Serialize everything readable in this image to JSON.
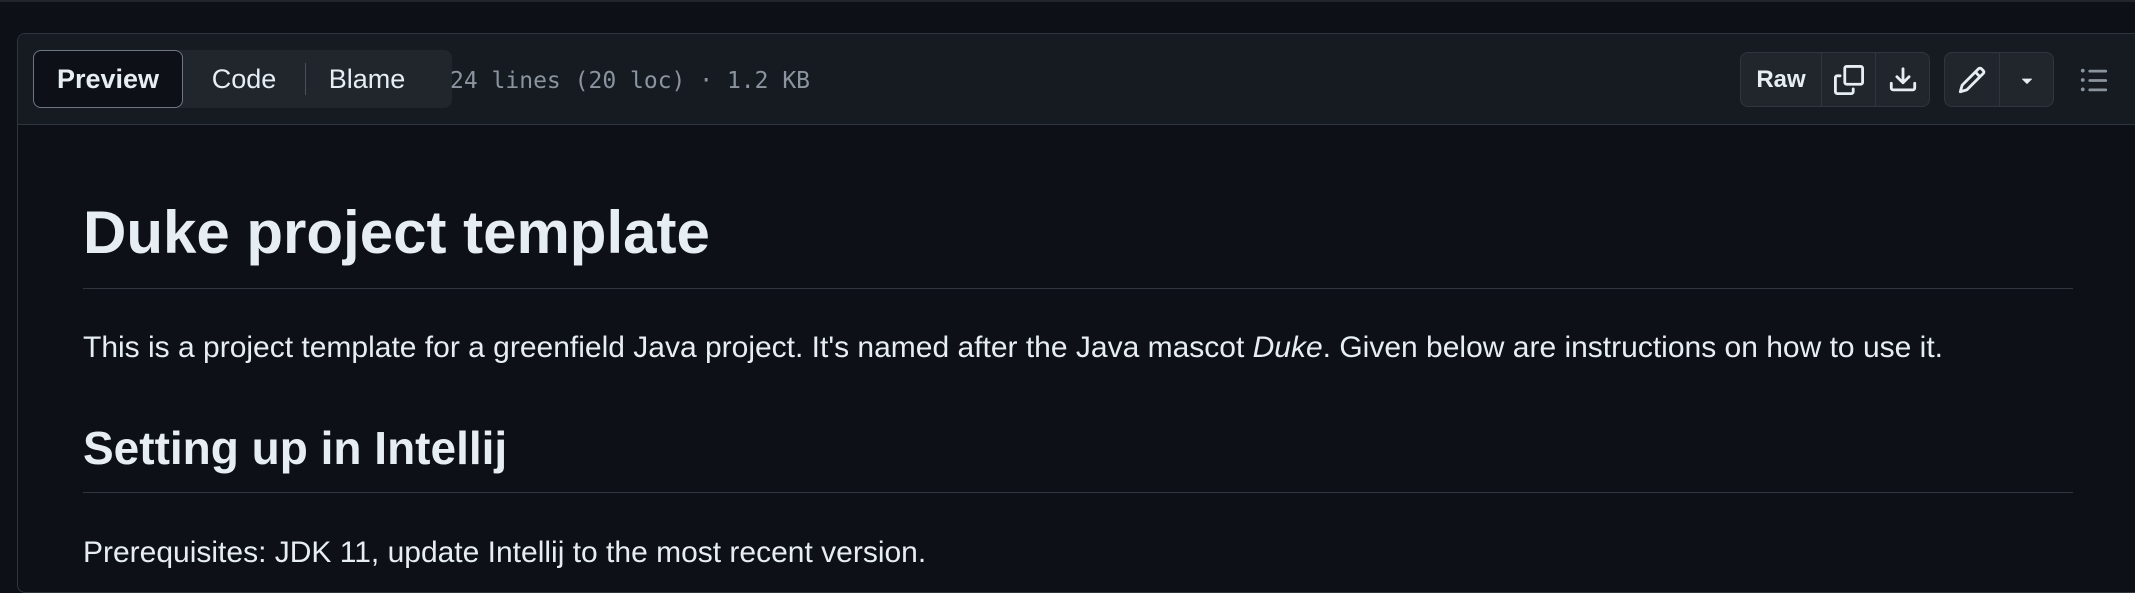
{
  "file_header": {
    "tabs": [
      {
        "label": "Preview",
        "active": true
      },
      {
        "label": "Code",
        "active": false
      },
      {
        "label": "Blame",
        "active": false
      }
    ],
    "file_info": "24 lines (20 loc) · 1.2 KB",
    "raw_label": "Raw",
    "icons": {
      "copy": "copy-icon",
      "download": "download-icon",
      "edit": "pencil-icon",
      "caret": "triangle-down-icon",
      "outline": "list-unordered-icon"
    }
  },
  "readme": {
    "title": "Duke project template",
    "intro_before": "This is a project template for a greenfield Java project. It's named after the Java mascot ",
    "intro_em": "Duke",
    "intro_after": ". Given below are instructions on how to use it.",
    "section_heading": "Setting up in Intellij",
    "prerequisites": "Prerequisites: JDK 11, update Intellij to the most recent version."
  },
  "colors": {
    "background": "#0d1117",
    "header_bg": "#161b22",
    "border": "#30363d",
    "text": "#e6edf3",
    "muted": "#8b949e"
  }
}
